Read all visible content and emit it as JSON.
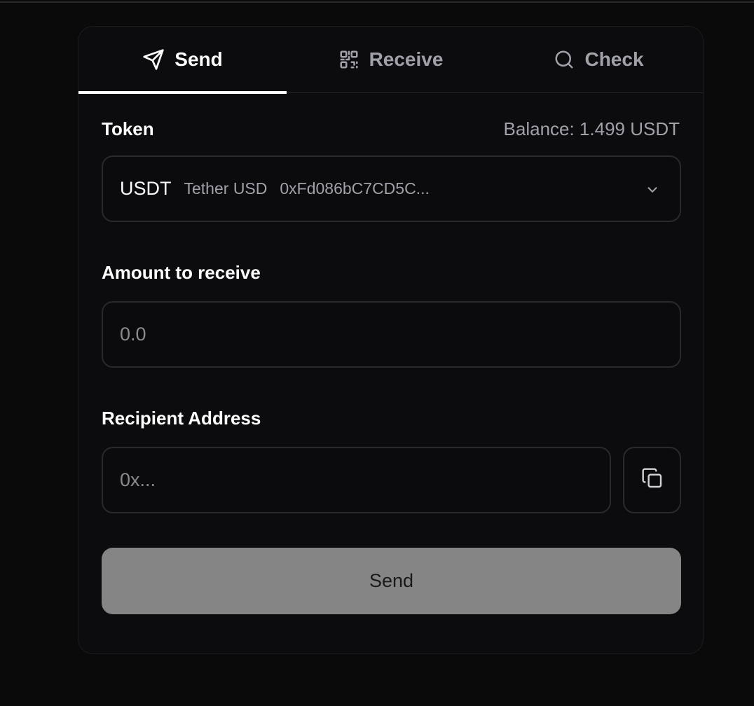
{
  "tabs": [
    {
      "label": "Send",
      "icon": "send-icon",
      "active": true
    },
    {
      "label": "Receive",
      "icon": "qr-code-icon",
      "active": false
    },
    {
      "label": "Check",
      "icon": "search-icon",
      "active": false
    }
  ],
  "token": {
    "label": "Token",
    "balance_text": "Balance: 1.499 USDT",
    "selected_symbol": "USDT",
    "selected_name": "Tether USD",
    "selected_address": "0xFd086bC7CD5C..."
  },
  "amount": {
    "label": "Amount to receive",
    "placeholder": "0.0",
    "value": ""
  },
  "recipient": {
    "label": "Recipient Address",
    "placeholder": "0x...",
    "value": ""
  },
  "actions": {
    "paste_icon": "copy-icon",
    "send_label": "Send"
  },
  "colors": {
    "background": "#0a0a0b",
    "card": "#0c0c0e",
    "border": "#2a2a2e",
    "muted_text": "#a1a1aa",
    "active_tab_underline": "#ffffff",
    "send_button_disabled": "#858585"
  }
}
